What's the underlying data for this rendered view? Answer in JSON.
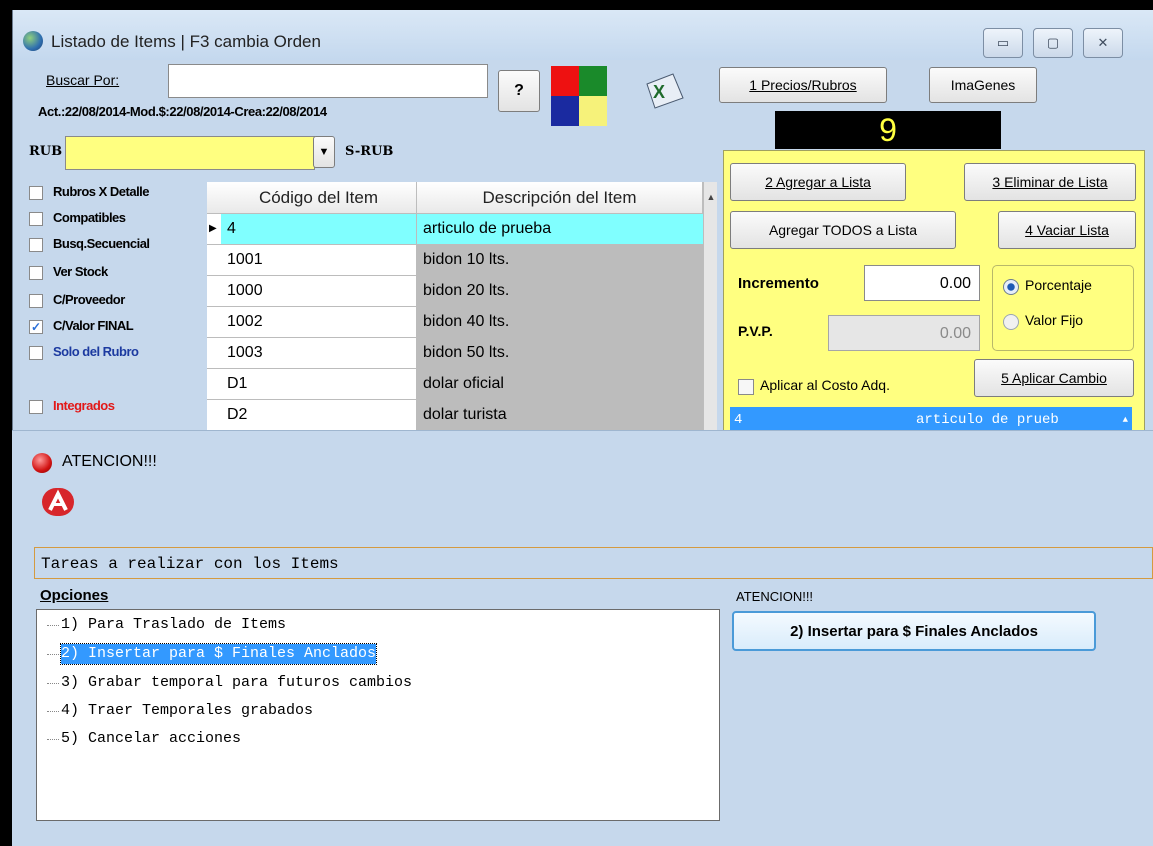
{
  "window": {
    "title": "Listado de Items | F3 cambia Orden",
    "controls": [
      "▭",
      "▢",
      "✕"
    ]
  },
  "search": {
    "label": "Buscar Por:",
    "value": "",
    "help_label": "?"
  },
  "dates_line": "Act.:22/08/2014-Mod.$:22/08/2014-Crea:22/08/2014",
  "rub": {
    "label": "RUB",
    "value": "",
    "srub_label": "S-RUB"
  },
  "top_buttons": {
    "precios": "1 Precios/Rubros",
    "imagenes": "ImaGenes"
  },
  "counter": "9",
  "panel": {
    "agregar": "2 Agregar a Lista",
    "eliminar": "3 Eliminar de Lista",
    "agregar_todos": "Agregar TODOS a Lista",
    "vaciar": "4 Vaciar Lista",
    "incremento_label": "Incremento",
    "incremento_value": "0.00",
    "pvp_label": "P.V.P.",
    "pvp_value": "0.00",
    "radio_porcentaje": "Porcentaje",
    "radio_valor_fijo": "Valor Fijo",
    "aplicar_costo": "Aplicar al Costo Adq.",
    "aplicar_cambio": "5 Aplicar Cambio",
    "selected_line_code": "4",
    "selected_line_desc": "articulo de prueb"
  },
  "filters": [
    {
      "label": "Rubros X Detalle",
      "checked": false
    },
    {
      "label": "Compatibles",
      "checked": false
    },
    {
      "label": "Busq.Secuencial",
      "checked": false
    },
    {
      "label": "Ver Stock",
      "checked": false
    },
    {
      "label": "C/Proveedor",
      "checked": false
    },
    {
      "label": "C/Valor FINAL",
      "checked": true
    },
    {
      "label": "Solo del Rubro",
      "checked": false
    },
    {
      "label": "Integrados",
      "checked": false
    }
  ],
  "grid": {
    "col_code": "Código del Item",
    "col_desc": "Descripción del Item",
    "rows": [
      {
        "code": "4",
        "desc": "articulo de prueba"
      },
      {
        "code": "1001",
        "desc": "bidon 10 lts."
      },
      {
        "code": "1000",
        "desc": "bidon 20 lts."
      },
      {
        "code": "1002",
        "desc": "bidon 40 lts."
      },
      {
        "code": "1003",
        "desc": "bidon 50 lts."
      },
      {
        "code": "D1",
        "desc": "dolar oficial"
      },
      {
        "code": "D2",
        "desc": "dolar turista"
      }
    ]
  },
  "dialog": {
    "title": "ATENCION!!!",
    "task": "Tareas a realizar con los Items",
    "options_label": "Opciones",
    "atencion_label": "ATENCION!!!",
    "action_button": "2) Insertar para $ Finales Anclados",
    "options": [
      "1) Para Traslado de Items",
      "2) Insertar para $ Finales Anclados",
      "3) Grabar temporal para futuros cambios",
      "4) Traer Temporales grabados",
      "5) Cancelar acciones"
    ],
    "selected_option": 1
  },
  "colors": {
    "window_bg": "#c6d8ec",
    "panel_yellow": "#ffff80",
    "highlight_cyan": "#80ffff",
    "selection_blue": "#3399ff"
  }
}
